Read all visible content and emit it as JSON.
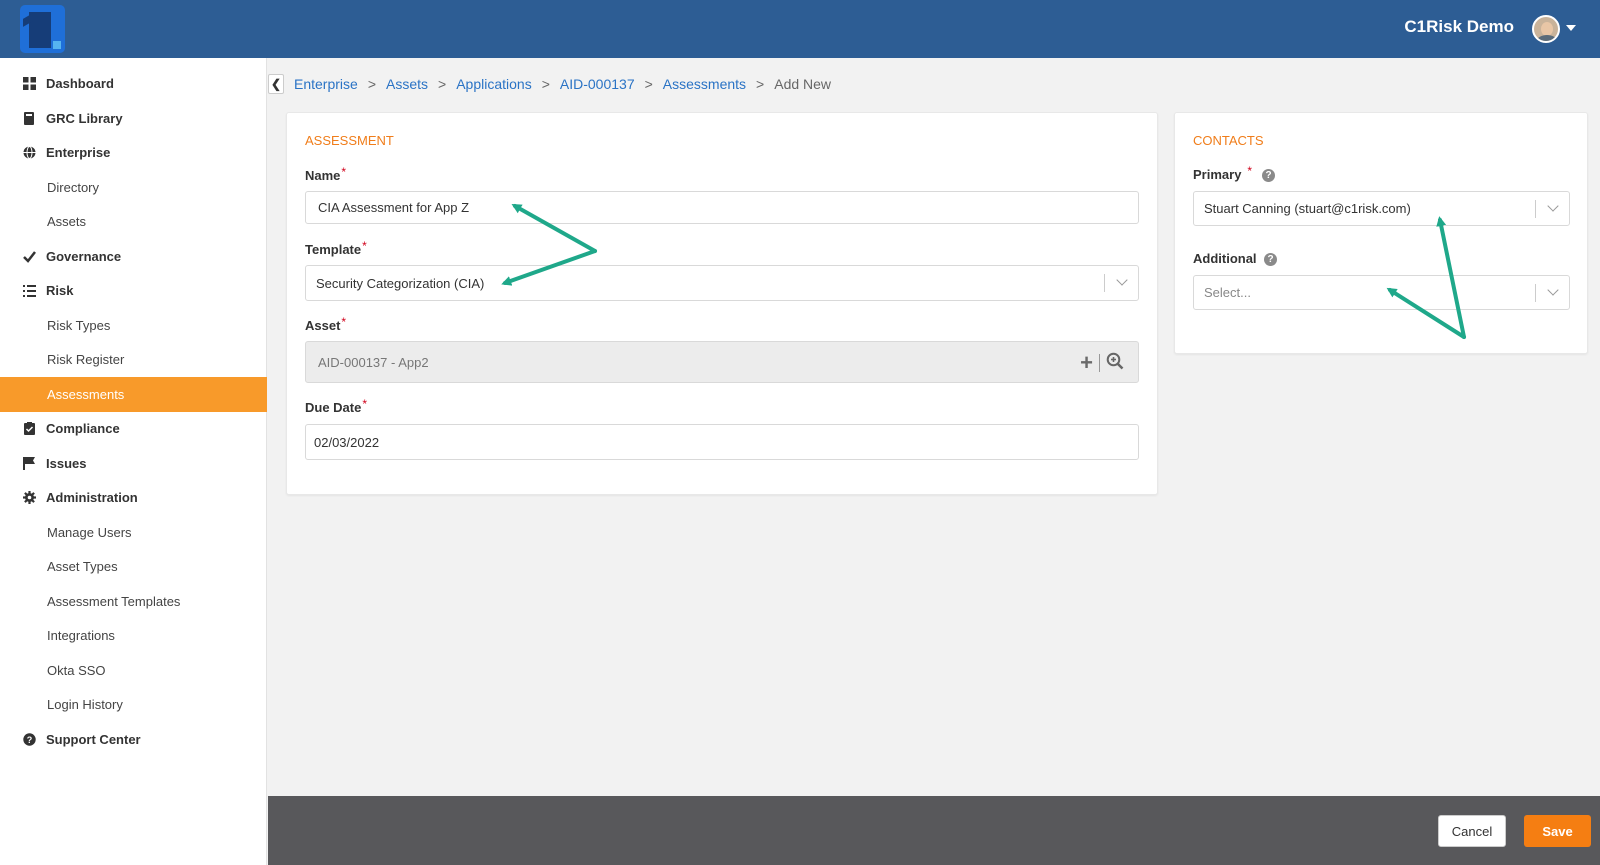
{
  "header": {
    "user_name": "C1Risk Demo"
  },
  "sidebar": {
    "items": [
      {
        "label": "Dashboard",
        "level": "top",
        "icon": "dashboard-icon"
      },
      {
        "label": "GRC Library",
        "level": "top",
        "icon": "book-icon"
      },
      {
        "label": "Enterprise",
        "level": "top",
        "icon": "globe-icon"
      },
      {
        "label": "Directory",
        "level": "sub"
      },
      {
        "label": "Assets",
        "level": "sub"
      },
      {
        "label": "Governance",
        "level": "top",
        "icon": "check-icon"
      },
      {
        "label": "Risk",
        "level": "top",
        "icon": "list-icon"
      },
      {
        "label": "Risk Types",
        "level": "sub"
      },
      {
        "label": "Risk Register",
        "level": "sub"
      },
      {
        "label": "Assessments",
        "level": "sub",
        "active": true
      },
      {
        "label": "Compliance",
        "level": "top",
        "icon": "clipboard-check-icon"
      },
      {
        "label": "Issues",
        "level": "top",
        "icon": "flag-icon"
      },
      {
        "label": "Administration",
        "level": "top",
        "icon": "gear-icon"
      },
      {
        "label": "Manage Users",
        "level": "sub"
      },
      {
        "label": "Asset Types",
        "level": "sub"
      },
      {
        "label": "Assessment Templates",
        "level": "sub"
      },
      {
        "label": "Integrations",
        "level": "sub"
      },
      {
        "label": "Okta SSO",
        "level": "sub"
      },
      {
        "label": "Login History",
        "level": "sub"
      },
      {
        "label": "Support Center",
        "level": "top",
        "icon": "question-circle-icon"
      }
    ]
  },
  "breadcrumb": {
    "links": [
      "Enterprise",
      "Assets",
      "Applications",
      "AID-000137",
      "Assessments"
    ],
    "separator": ">",
    "current": "Add New"
  },
  "assessment": {
    "title": "ASSESSMENT",
    "name_label": "Name",
    "name_value": "CIA Assessment for App Z",
    "template_label": "Template",
    "template_value": "Security Categorization (CIA)",
    "asset_label": "Asset",
    "asset_value": "AID-000137 - App2",
    "due_date_label": "Due Date",
    "due_date_value": "02/03/2022",
    "required_mark": "*"
  },
  "contacts": {
    "title": "CONTACTS",
    "primary_label": "Primary",
    "primary_value": "Stuart Canning (stuart@c1risk.com)",
    "additional_label": "Additional",
    "additional_placeholder": "Select...",
    "required_mark": "*"
  },
  "footer": {
    "cancel_label": "Cancel",
    "save_label": "Save"
  },
  "colors": {
    "header_bg": "#2d5d94",
    "accent_orange": "#f89a2a",
    "link_blue": "#2a73c5",
    "annotation_arrow": "#1fa88a",
    "footer_bg": "#58585b"
  }
}
